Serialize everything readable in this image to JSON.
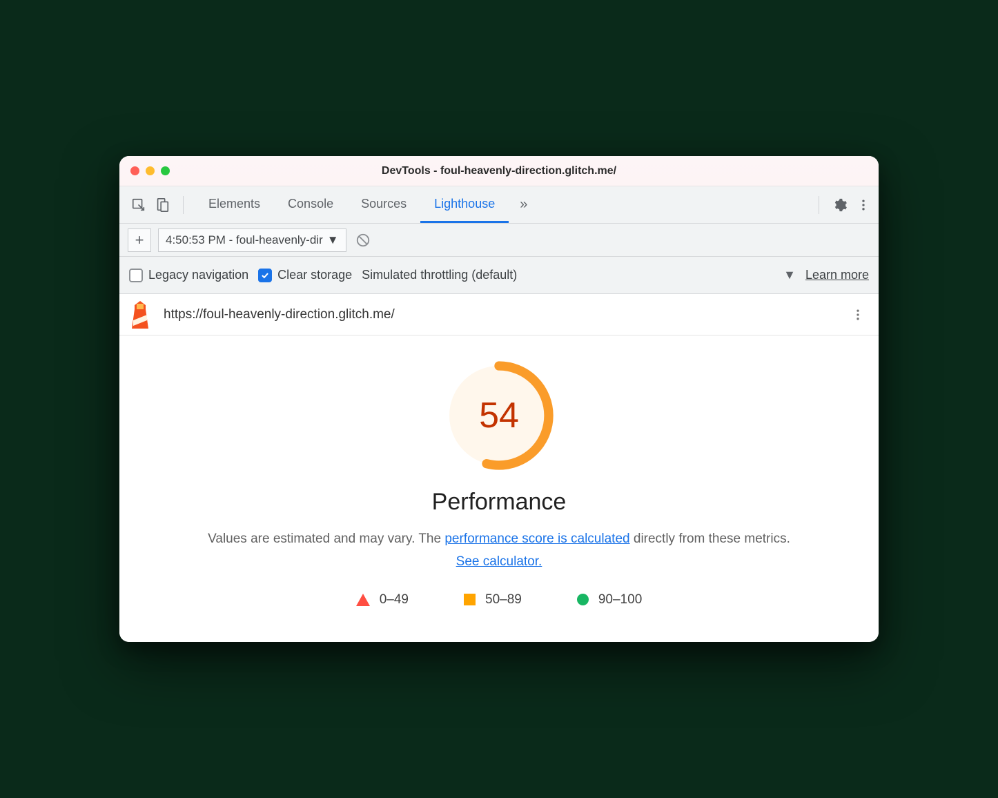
{
  "window": {
    "title": "DevTools - foul-heavenly-direction.glitch.me/"
  },
  "tabs": {
    "elements": "Elements",
    "console": "Console",
    "sources": "Sources",
    "lighthouse": "Lighthouse"
  },
  "subbar": {
    "report_label": "4:50:53 PM - foul-heavenly-dir"
  },
  "options": {
    "legacy_label": "Legacy navigation",
    "clear_label": "Clear storage",
    "throttling_label": "Simulated throttling (default)",
    "learn_more": "Learn more"
  },
  "urlbar": {
    "url": "https://foul-heavenly-direction.glitch.me/"
  },
  "report": {
    "score": "54",
    "category": "Performance",
    "desc_pre": "Values are estimated and may vary. The ",
    "desc_link1": "performance score is calculated",
    "desc_mid": " directly from these metrics. ",
    "desc_link2": "See calculator.",
    "legend": {
      "fail": "0–49",
      "avg": "50–89",
      "pass": "90–100"
    }
  },
  "chart_data": {
    "type": "gauge",
    "title": "Performance",
    "value": 54,
    "min": 0,
    "max": 100,
    "ranges": [
      {
        "label": "0–49",
        "color": "#ff4e42"
      },
      {
        "label": "50–89",
        "color": "#ffa400"
      },
      {
        "label": "90–100",
        "color": "#18b663"
      }
    ]
  }
}
